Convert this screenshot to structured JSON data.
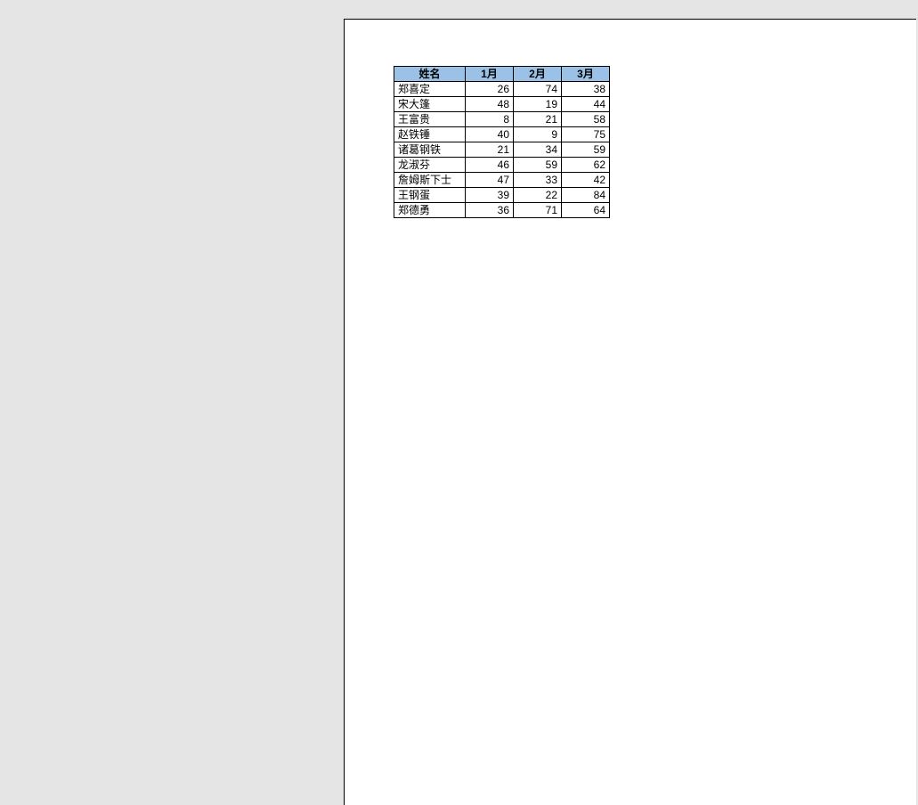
{
  "table": {
    "headers": [
      "姓名",
      "1月",
      "2月",
      "3月"
    ],
    "rows": [
      {
        "name": "郑喜定",
        "v1": 26,
        "v2": 74,
        "v3": 38
      },
      {
        "name": "宋大篷",
        "v1": 48,
        "v2": 19,
        "v3": 44
      },
      {
        "name": "王富贵",
        "v1": 8,
        "v2": 21,
        "v3": 58
      },
      {
        "name": "赵铁锤",
        "v1": 40,
        "v2": 9,
        "v3": 75
      },
      {
        "name": "诸葛钢铁",
        "v1": 21,
        "v2": 34,
        "v3": 59
      },
      {
        "name": "龙淑芬",
        "v1": 46,
        "v2": 59,
        "v3": 62
      },
      {
        "name": "詹姆斯下士",
        "v1": 47,
        "v2": 33,
        "v3": 42
      },
      {
        "name": "王钢蛋",
        "v1": 39,
        "v2": 22,
        "v3": 84
      },
      {
        "name": "郑德勇",
        "v1": 36,
        "v2": 71,
        "v3": 64
      }
    ]
  },
  "chart_data": {
    "type": "table",
    "title": "",
    "columns": [
      "姓名",
      "1月",
      "2月",
      "3月"
    ],
    "rows": [
      [
        "郑喜定",
        26,
        74,
        38
      ],
      [
        "宋大篷",
        48,
        19,
        44
      ],
      [
        "王富贵",
        8,
        21,
        58
      ],
      [
        "赵铁锤",
        40,
        9,
        75
      ],
      [
        "诸葛钢铁",
        21,
        34,
        59
      ],
      [
        "龙淑芬",
        46,
        59,
        62
      ],
      [
        "詹姆斯下士",
        47,
        33,
        42
      ],
      [
        "王钢蛋",
        39,
        22,
        84
      ],
      [
        "郑德勇",
        36,
        71,
        64
      ]
    ]
  }
}
